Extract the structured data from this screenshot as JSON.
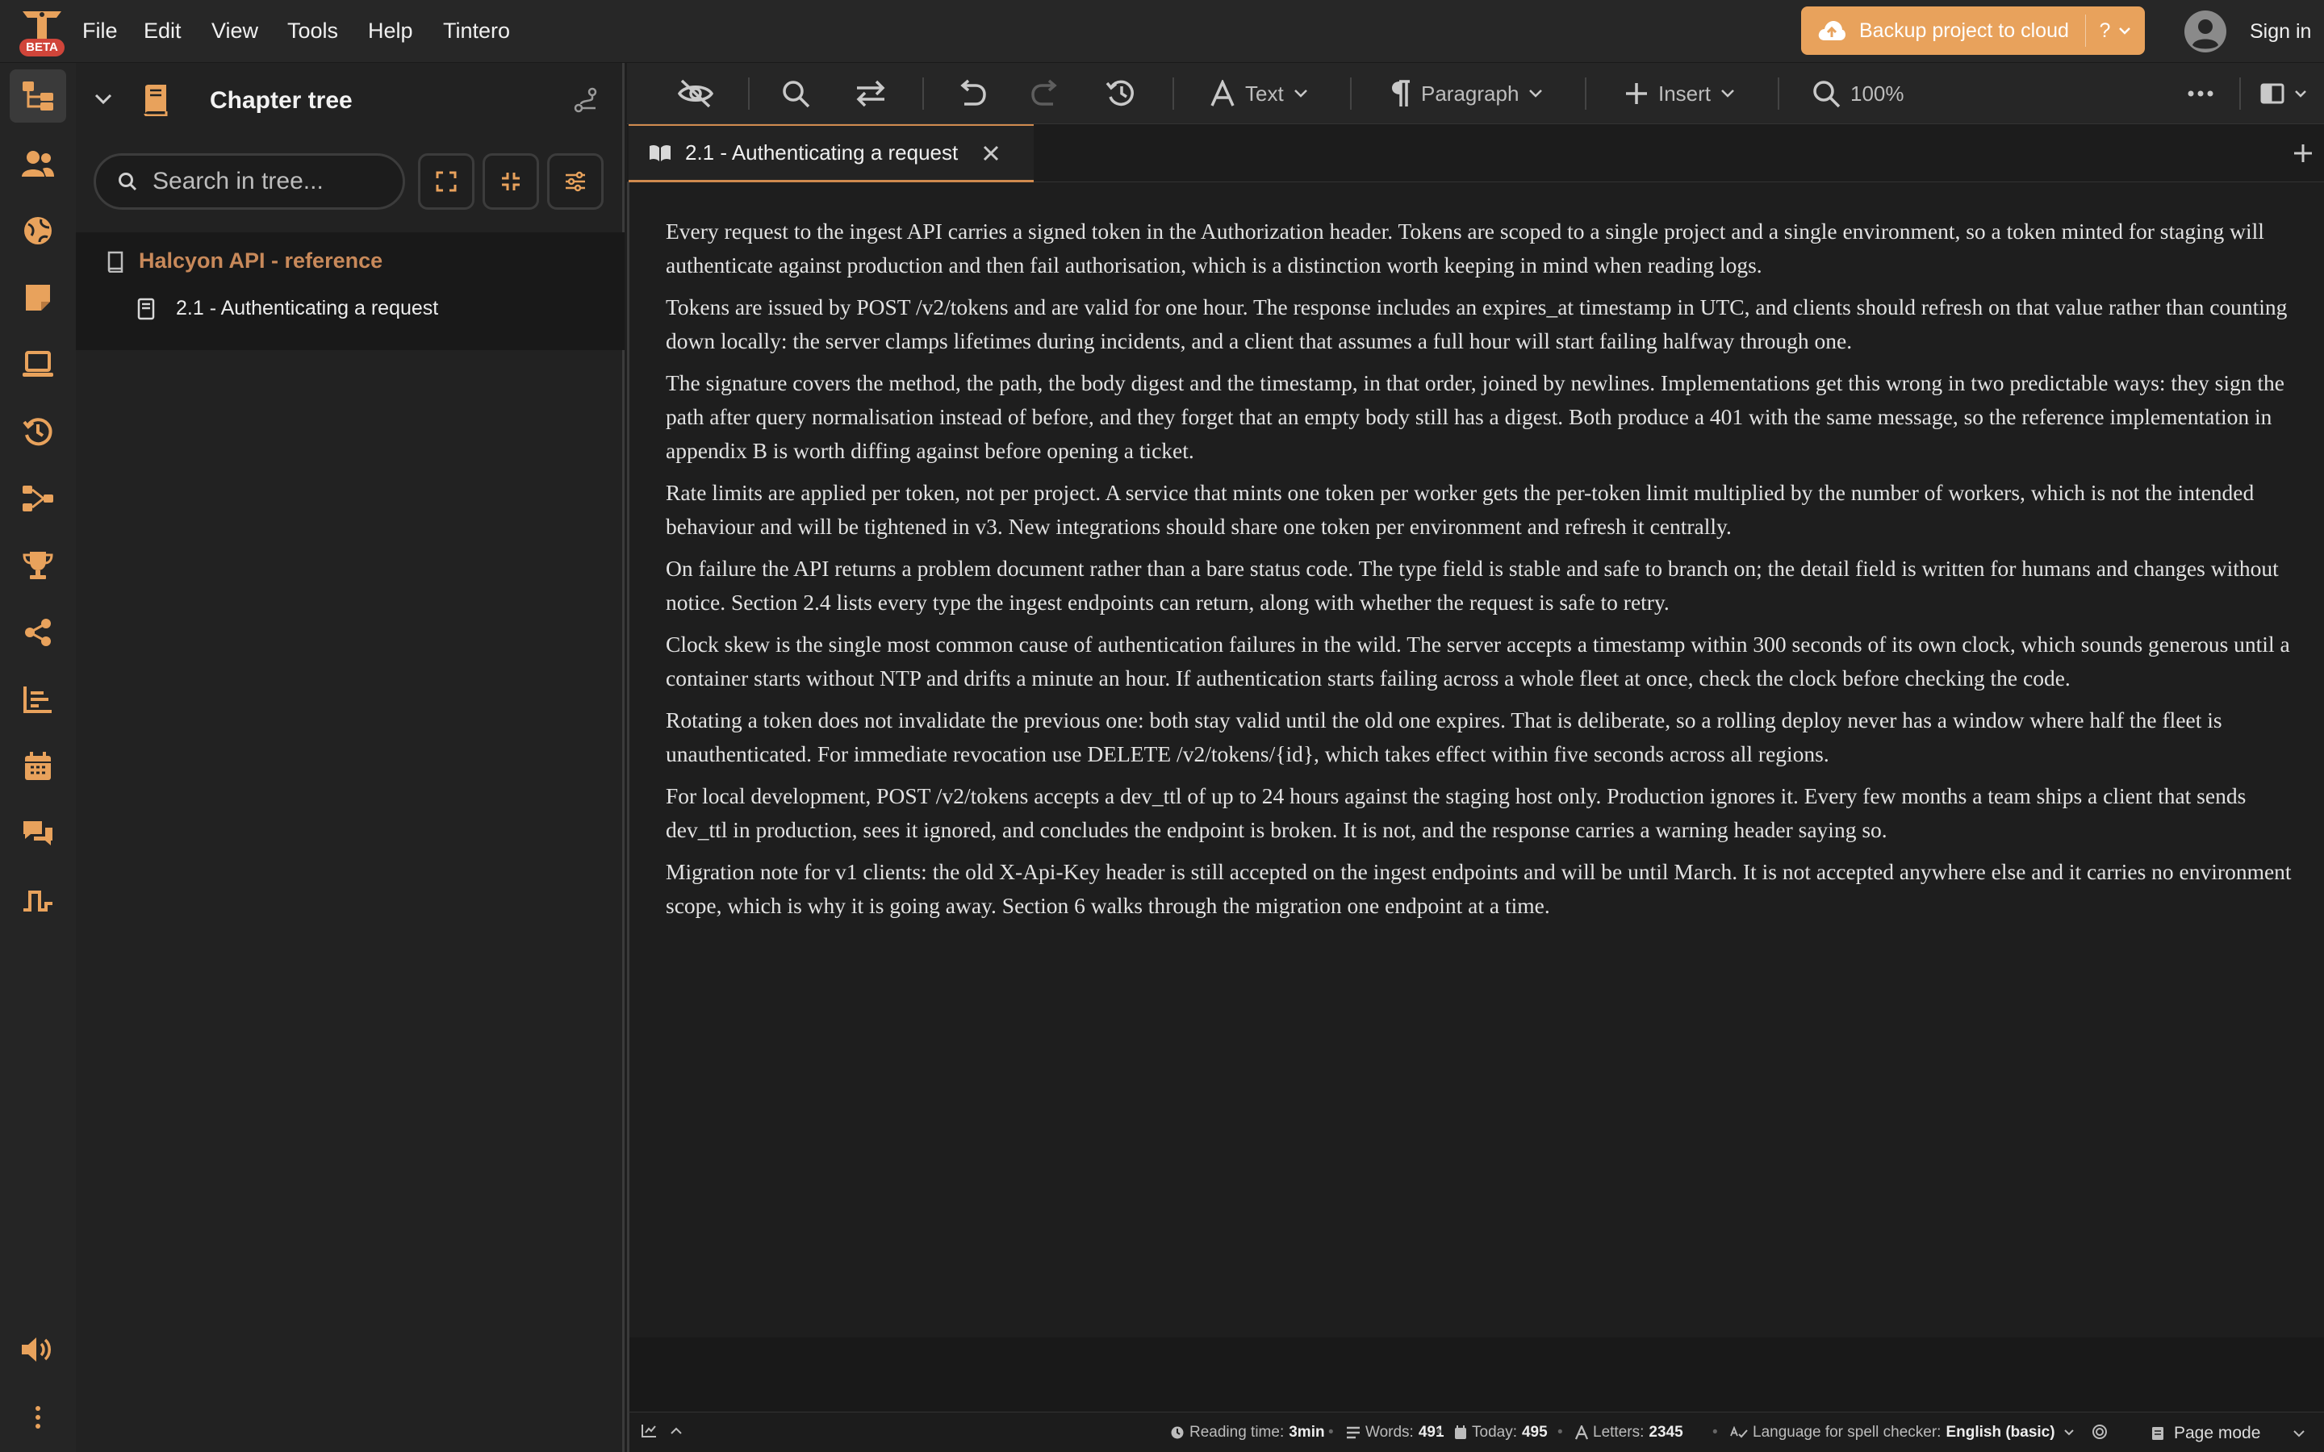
{
  "menu": {
    "items": [
      "File",
      "Edit",
      "View",
      "Tools",
      "Help",
      "Tintero"
    ],
    "logo_badge": "BETA"
  },
  "header_actions": {
    "backup_label": "Backup project to cloud",
    "help_label": "?",
    "signin_label": "Sign in"
  },
  "tree": {
    "title": "Chapter tree",
    "search_placeholder": "Search in tree...",
    "root_label": "Halcyon API - reference",
    "child_label": "2.1 - Authenticating a request"
  },
  "toolbar": {
    "text_label": "Text",
    "paragraph_label": "Paragraph",
    "insert_label": "Insert",
    "zoom_label": "100%"
  },
  "tab": {
    "label": "2.1 - Authenticating a request"
  },
  "document": {
    "paragraphs": [
      "Every request to the ingest API carries a signed token in the Authorization header. Tokens are scoped to a single project and a single environment, so a token minted for staging will authenticate against production and then fail authorisation, which is a distinction worth keeping in mind when reading logs.",
      "Tokens are issued by POST /v2/tokens and are valid for one hour. The response includes an expires_at timestamp in UTC, and clients should refresh on that value rather than counting down locally: the server clamps lifetimes during incidents, and a client that assumes a full hour will start failing halfway through one.",
      "The signature covers the method, the path, the body digest and the timestamp, in that order, joined by newlines. Implementations get this wrong in two predictable ways: they sign the path after query normalisation instead of before, and they forget that an empty body still has a digest. Both produce a 401 with the same message, so the reference implementation in appendix B is worth diffing against before opening a ticket.",
      "Rate limits are applied per token, not per project. A service that mints one token per worker gets the per-token limit multiplied by the number of workers, which is not the intended behaviour and will be tightened in v3. New integrations should share one token per environment and refresh it centrally.",
      "On failure the API returns a problem document rather than a bare status code. The type field is stable and safe to branch on; the detail field is written for humans and changes without notice. Section 2.4 lists every type the ingest endpoints can return, along with whether the request is safe to retry.",
      "Clock skew is the single most common cause of authentication failures in the wild. The server accepts a timestamp within 300 seconds of its own clock, which sounds generous until a container starts without NTP and drifts a minute an hour. If authentication starts failing across a whole fleet at once, check the clock before checking the code.",
      "Rotating a token does not invalidate the previous one: both stay valid until the old one expires. That is deliberate, so a rolling deploy never has a window where half the fleet is unauthenticated. For immediate revocation use DELETE /v2/tokens/{id}, which takes effect within five seconds across all regions.",
      "For local development, POST /v2/tokens accepts a dev_ttl of up to 24 hours against the staging host only. Production ignores it. Every few months a team ships a client that sends dev_ttl in production, sees it ignored, and concludes the endpoint is broken. It is not, and the response carries a warning header saying so.",
      "Migration note for v1 clients: the old X-Api-Key header is still accepted on the ingest endpoints and will be until March. It is not accepted anywhere else and it carries no environment scope, which is why it is going away. Section 6 walks through the migration one endpoint at a time."
    ]
  },
  "status": {
    "reading_label": "Reading time:",
    "reading_value": "3min",
    "words_label": "Words:",
    "words_value": "491",
    "today_label": "Today:",
    "today_value": "495",
    "letters_label": "Letters:",
    "letters_value": "2345",
    "lang_label": "Language for spell checker:",
    "lang_value": "English (basic)",
    "mode_label": "Page mode"
  },
  "colors": {
    "accent": "#e8a25c",
    "tree_root": "#c8895a",
    "beta_badge": "#d0453a"
  }
}
